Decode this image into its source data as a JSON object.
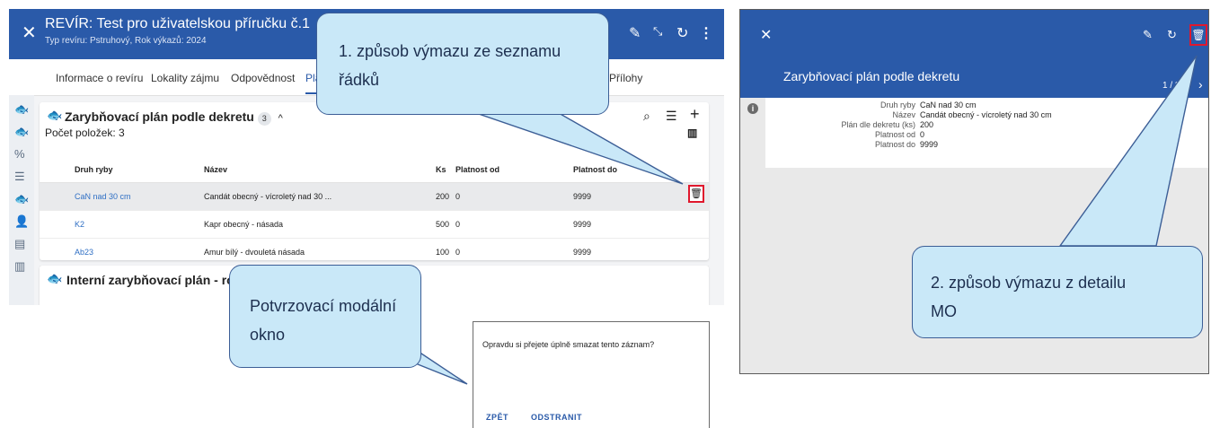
{
  "left_app": {
    "header": {
      "title": "REVÍR: Test pro uživatelskou příručku č.1",
      "subtitle": "Typ revíru: Pstruhový, Rok výkazů: 2024",
      "close_icon": "close-icon",
      "edit_icon": "edit-icon",
      "collapse_icon": "collapse-icon",
      "refresh_icon": "refresh-icon",
      "more_icon": "more-vert-icon"
    },
    "tabs": [
      "Informace o revíru",
      "Lokality zájmu",
      "Odpovědnost",
      "Pla",
      "Přílohy"
    ],
    "active_tab_index": 3,
    "section1": {
      "title": "Zarybňovací plán podle dekretu",
      "badge": "3",
      "count_label": "Počet položek: 3",
      "columns": [
        "Druh ryby",
        "Název",
        "Ks",
        "Platnost od",
        "Platnost do"
      ],
      "rows": [
        {
          "druh": "CaN nad 30 cm",
          "nazev": "Candát obecný - vícroletý nad 30 ...",
          "ks": "200",
          "od": "0",
          "do": "9999"
        },
        {
          "druh": "K2",
          "nazev": "Kapr obecný - násada",
          "ks": "500",
          "od": "0",
          "do": "9999"
        },
        {
          "druh": "Ab23",
          "nazev": "Amur bílý - dvouletá násada",
          "ks": "100",
          "od": "0",
          "do": "9999"
        }
      ]
    },
    "section2": {
      "title": "Interní zarybňovací plán - rok 20"
    }
  },
  "callouts": {
    "c1": "1. způsob výmazu ze seznamu řádků",
    "c2": "Potvrzovací modální okno",
    "c3": "2. způsob výmazu z detailu MO"
  },
  "modal": {
    "message": "Opravdu si přejete úplně smazat tento záznam?",
    "back": "ZPĚT",
    "delete": "ODSTRANIT"
  },
  "right_app": {
    "title": "Zarybňovací plán podle dekretu",
    "pager": "1 / 3",
    "details": [
      {
        "label": "Druh ryby",
        "value": "CaN nad 30 cm",
        "link": true
      },
      {
        "label": "Název",
        "value": "Candát obecný - vícroletý nad 30 cm",
        "link": false
      },
      {
        "label": "Plán dle dekretu (ks)",
        "value": "200",
        "link": false
      },
      {
        "label": "Platnost od",
        "value": "0",
        "link": false
      },
      {
        "label": "Platnost do",
        "value": "9999",
        "link": false
      }
    ]
  },
  "colors": {
    "header_blue": "#2a5aa9",
    "callout_fill": "#c9e8f8",
    "highlight_red": "#e0182d",
    "link_blue": "#2f6fc4"
  }
}
